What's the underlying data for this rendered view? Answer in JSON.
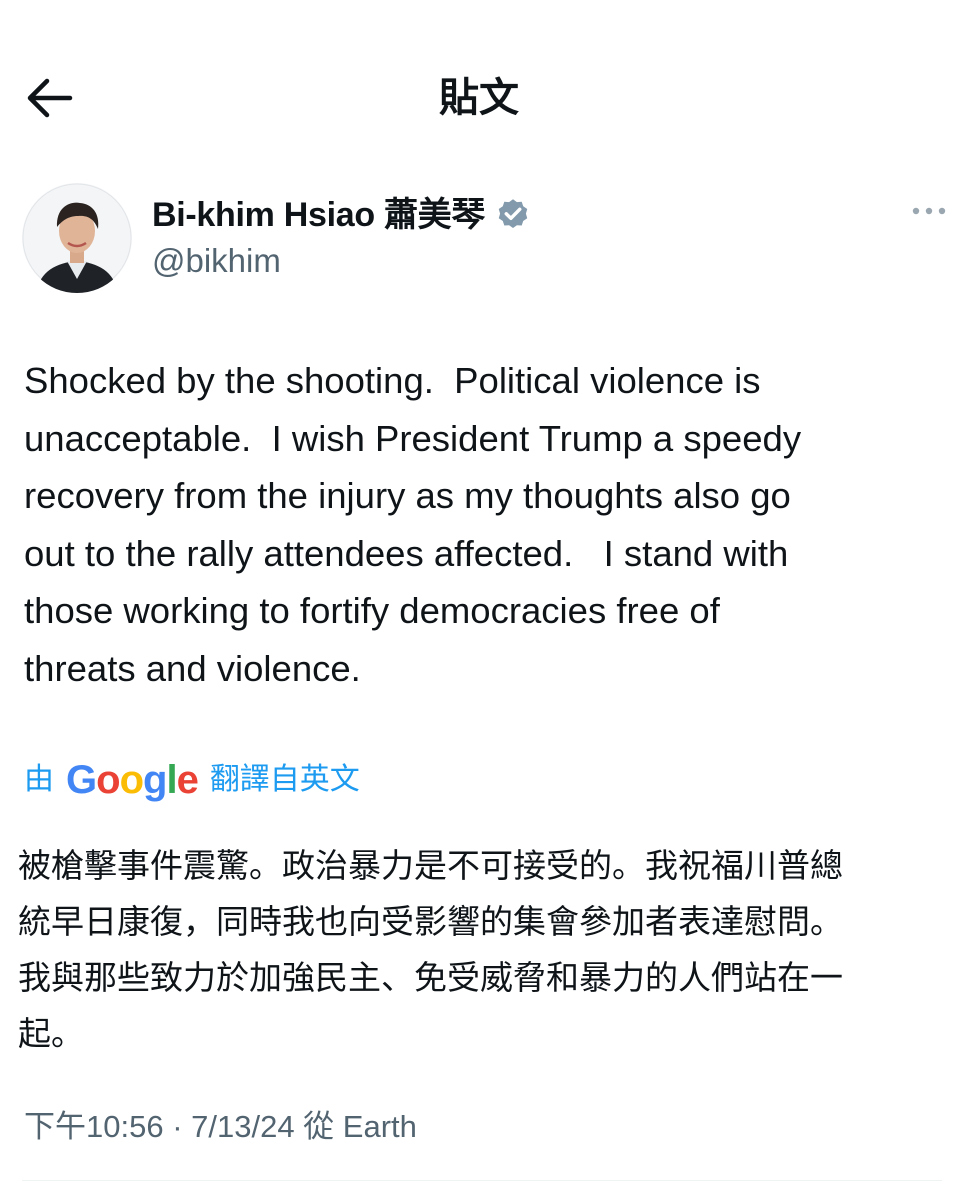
{
  "header": {
    "title": "貼文"
  },
  "author": {
    "display_name": "Bi-khim Hsiao 蕭美琴",
    "handle": "@bikhim",
    "verified_color": "#829aab"
  },
  "tweet": {
    "text": "Shocked by the shooting.  Political violence is\nunacceptable.  I wish President Trump a speedy\nrecovery from the injury as my thoughts also go\nout to the rally attendees affected.   I stand with\nthose working to fortify democracies free of\nthreats and violence."
  },
  "translation": {
    "prefix": "由",
    "provider_letters": [
      "G",
      "o",
      "o",
      "g",
      "l",
      "e"
    ],
    "provider_colors": [
      "#4285f4",
      "#ea4335",
      "#fbbc05",
      "#4285f4",
      "#34a853",
      "#ea4335"
    ],
    "suffix": "翻譯自英文",
    "text": "被槍擊事件震驚。政治暴力是不可接受的。我祝福川普總\n統早日康復，同時我也向受影響的集會參加者表達慰問。\n我與那些致力於加強民主、免受威脅和暴力的人們站在一\n起。"
  },
  "meta": {
    "timestamp": "下午10:56 · 7/13/24 從 Earth"
  },
  "colors": {
    "accent": "#1d9bf0",
    "text_primary": "#0f1419",
    "text_secondary": "#536471"
  },
  "icons": {
    "back": "arrow-left-icon",
    "verified": "verified-badge-icon",
    "more": "more-horizontal-icon"
  }
}
